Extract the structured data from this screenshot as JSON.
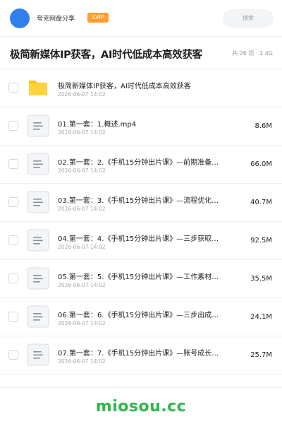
{
  "header": {
    "brand": "夸克网盘分享",
    "badge": "SVIP",
    "search_placeholder": "搜索"
  },
  "share": {
    "title": "极简新媒体IP获客，AI时代低成本高效获客",
    "stats": "共 26 项 · 1.4G"
  },
  "files": [
    {
      "type": "folder-icon",
      "name": "极简新媒体IP获客，AI时代低成本高效获客",
      "date": "2026-06-07 14:02",
      "size": ""
    },
    {
      "type": "document-icon",
      "name": "01.第一套：1.概述.mp4",
      "date": "2026-06-07 14:02",
      "size": "8.6M"
    },
    {
      "type": "document-icon",
      "name": "02.第一套：2.《手机15分钟出片课》—前期准备…",
      "date": "2026-06-07 14:02",
      "size": "66.0M"
    },
    {
      "type": "document-icon",
      "name": "03.第一套：3.《手机15分钟出片课》—流程优化…",
      "date": "2026-06-07 14:02",
      "size": "40.7M"
    },
    {
      "type": "document-icon",
      "name": "04.第一套：4.《手机15分钟出片课》—三步获取…",
      "date": "2026-06-07 14:02",
      "size": "92.5M"
    },
    {
      "type": "document-icon",
      "name": "05.第一套：5.《手机15分钟出片课》—工作素材…",
      "date": "2026-06-07 14:02",
      "size": "35.5M"
    },
    {
      "type": "document-icon",
      "name": "06.第一套：6.《手机15分钟出片课》—三步出成…",
      "date": "2026-06-07 14:02",
      "size": "24.1M"
    },
    {
      "type": "document-icon",
      "name": "07.第一套：7.《手机15分钟出片课》—账号成长…",
      "date": "2026-06-07 14:02",
      "size": "25.7M"
    }
  ],
  "watermark": "miosou.cc",
  "colors": {
    "accent": "#2f80ed",
    "badge": "#ff9e2c",
    "folder": "#ffc400",
    "watermark": "#2db84d"
  }
}
